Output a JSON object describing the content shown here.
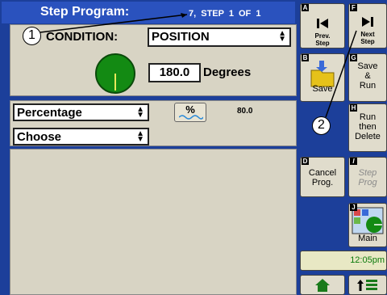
{
  "header": {
    "title": "Step Program:",
    "step_text": "7, STEP  1  OF  1"
  },
  "condition": {
    "label": "CONDITION:",
    "selected": "POSITION",
    "degrees_value": "180.0",
    "degrees_unit": "Degrees"
  },
  "options": {
    "mode_selected": "Percentage",
    "percent_button": "%",
    "percent_value": "80.0",
    "choose_selected": "Choose"
  },
  "sidebar": {
    "prev": {
      "letter": "A",
      "label": "Prev.\nStep"
    },
    "next": {
      "letter": "F",
      "label": "Next\nStep"
    },
    "save": {
      "letter": "B",
      "label": "Save"
    },
    "save_run": {
      "letter": "G",
      "label": "Save\n&\nRun"
    },
    "run_delete": {
      "letter": "H",
      "label": "Run\nthen\nDelete"
    },
    "cancel": {
      "letter": "D",
      "label": "Cancel\nProg."
    },
    "step_prog": {
      "letter": "I",
      "label": "Step\nProg"
    },
    "main": {
      "letter": "J",
      "label": "Main"
    },
    "time": "12:05pm"
  },
  "callouts": {
    "one": "1",
    "two": "2"
  },
  "colors": {
    "frame": "#1c3f9a",
    "panel": "#d8d4c4",
    "gauge": "#138a13",
    "time_text": "#0a7a0a"
  }
}
